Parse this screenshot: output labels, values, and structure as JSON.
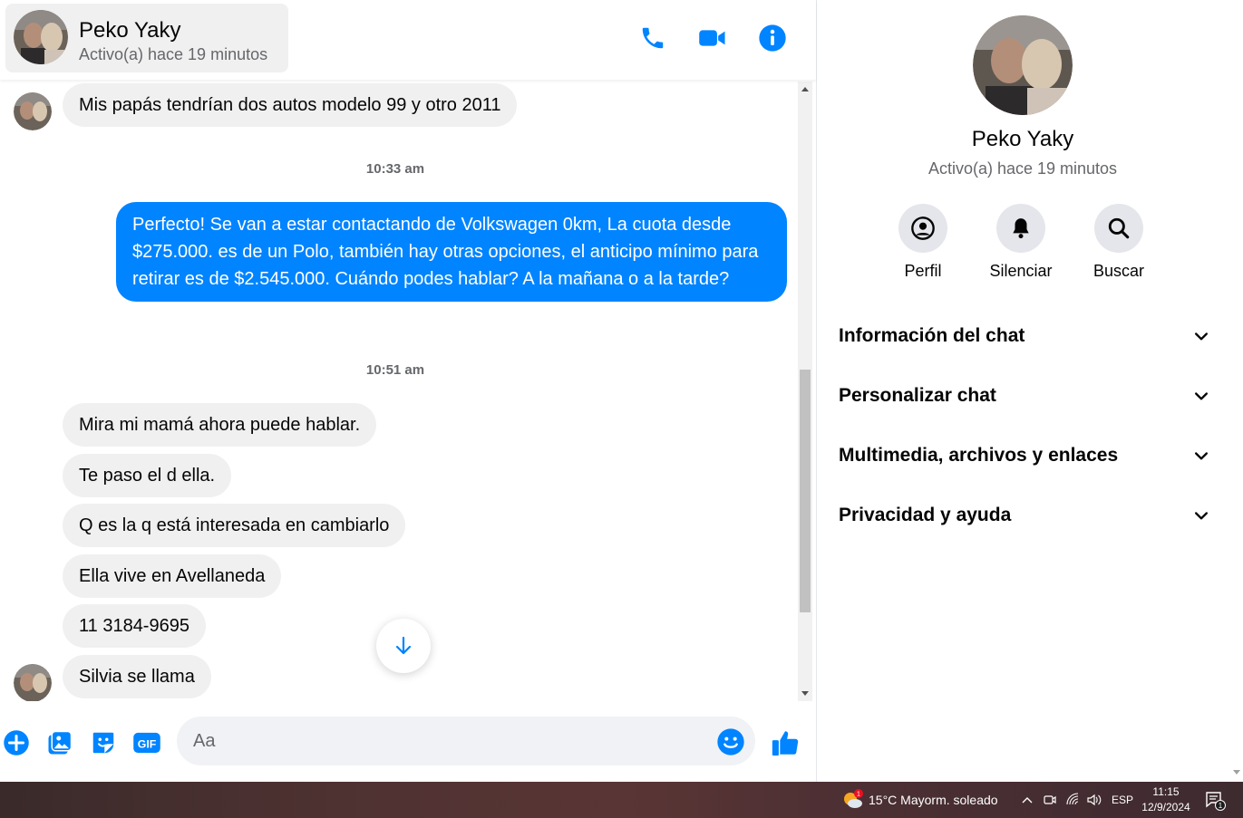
{
  "colors": {
    "messenger_blue": "#0084ff",
    "incoming_bubble": "#f0f0f0",
    "muted_text": "#65676b"
  },
  "header": {
    "name": "Peko Yaky",
    "status": "Activo(a) hace 19 minutos",
    "actions": [
      {
        "icon": "phone-icon"
      },
      {
        "icon": "video-camera-icon"
      },
      {
        "icon": "info-icon"
      }
    ]
  },
  "conversation": {
    "message_1": "Mis papás tendrían dos autos modelo 99 y otro 2011",
    "time_1": "10:33 am",
    "outgoing_1": "Perfecto!  Se van a estar contactando de Volkswagen 0km, La cuota desde $275.000. es de un Polo, también hay otras opciones, el anticipo mínimo para retirar es de $2.545.000. Cuándo podes hablar? A la mañana o a la tarde?",
    "time_2": "10:51 am",
    "incoming": [
      "Mira mi mamá ahora puede hablar.",
      "Te paso el d ella.",
      "Q es la q está interesada en cambiarlo",
      "Ella vive en Avellaneda",
      "11 3184-9695",
      "Silvia se llama"
    ]
  },
  "composer": {
    "placeholder": "Aa",
    "icons": [
      "add-icon",
      "image-icon",
      "sticker-icon",
      "gif-icon",
      "emoji-icon",
      "thumbs-up-icon"
    ],
    "gif_label": "GIF"
  },
  "side_panel": {
    "name": "Peko Yaky",
    "status": "Activo(a) hace 19 minutos",
    "actions": [
      {
        "label": "Perfil",
        "icon": "profile-icon"
      },
      {
        "label": "Silenciar",
        "icon": "bell-icon"
      },
      {
        "label": "Buscar",
        "icon": "search-icon"
      }
    ],
    "sections": [
      "Información del chat",
      "Personalizar chat",
      "Multimedia, archivos y enlaces",
      "Privacidad y ayuda"
    ]
  },
  "taskbar": {
    "weather_badge": "1",
    "weather": "15°C  Mayorm. soleado",
    "language": "ESP",
    "time": "11:15",
    "date": "12/9/2024",
    "notification_count": "1",
    "tray_icons": [
      "chevron-up-icon",
      "meet-icon",
      "wifi-icon",
      "volume-icon",
      "notifications-icon"
    ]
  }
}
